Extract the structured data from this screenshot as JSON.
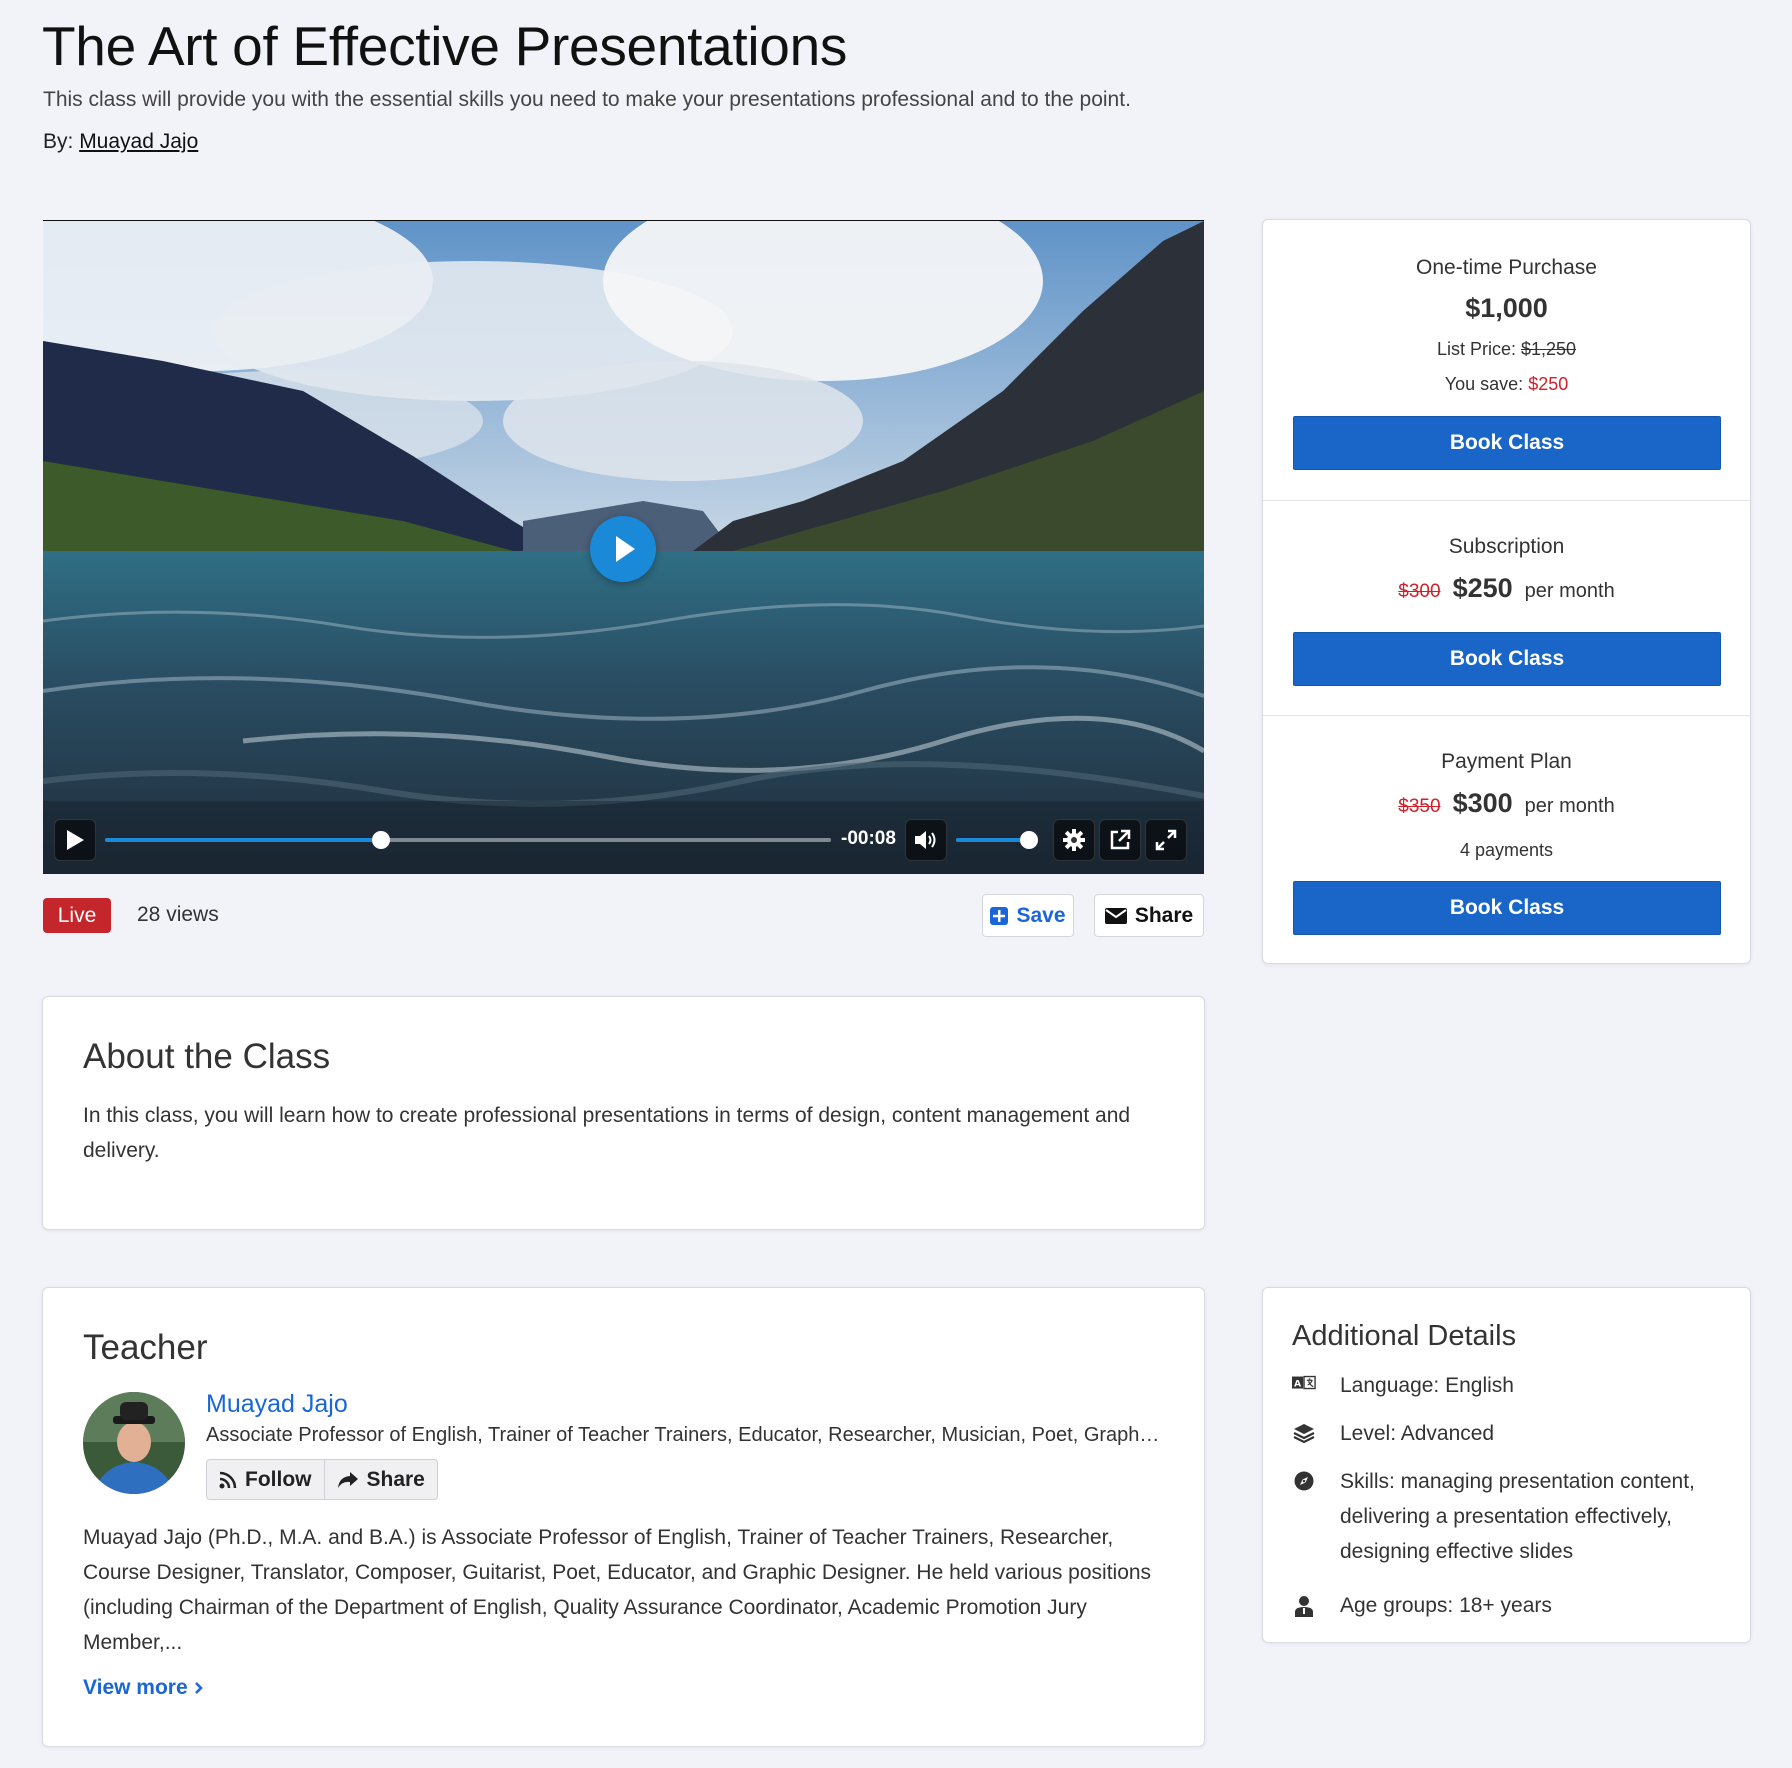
{
  "header": {
    "title": "The Art of Effective Presentations",
    "subtitle": "This class will provide you with the essential skills you need to make your presentations professional and to the point.",
    "by_label": "By:",
    "author": "Muayad Jajo"
  },
  "video": {
    "time_remaining": "-00:08",
    "progress": 0.38,
    "volume": 1.0
  },
  "stats": {
    "live_label": "Live",
    "views": "28 views",
    "save_label": "Save",
    "share_label": "Share"
  },
  "pricing": {
    "one_time": {
      "title": "One-time Purchase",
      "price": "$1,000",
      "list_price_label": "List Price:",
      "list_price": "$1,250",
      "you_save_label": "You save:",
      "you_save": "$250",
      "button": "Book Class"
    },
    "subscription": {
      "title": "Subscription",
      "old_price": "$300",
      "price": "$250",
      "period": "per month",
      "button": "Book Class"
    },
    "payment_plan": {
      "title": "Payment Plan",
      "old_price": "$350",
      "price": "$300",
      "period": "per month",
      "payments": "4 payments",
      "button": "Book Class"
    }
  },
  "about": {
    "heading": "About the Class",
    "text": "In this class, you will learn how to create professional presentations in terms of design, content management and delivery."
  },
  "teacher": {
    "heading": "Teacher",
    "name": "Muayad Jajo",
    "roles": "Associate Professor of English, Trainer of Teacher Trainers, Educator, Researcher, Musician, Poet, Graphic Designer",
    "follow_label": "Follow",
    "share_label": "Share",
    "bio": "Muayad Jajo (Ph.D., M.A. and B.A.) is Associate Professor of English, Trainer of Teacher Trainers, Researcher, Course Designer, Translator, Composer, Guitarist, Poet, Educator, and Graphic Designer.  He held various positions (including Chairman of the Department of English, Quality Assurance Coordinator, Academic Promotion Jury Member,...",
    "view_more": "View more"
  },
  "details": {
    "heading": "Additional Details",
    "items": [
      {
        "icon": "language-icon",
        "text": "Language: English"
      },
      {
        "icon": "layers-icon",
        "text": "Level: Advanced"
      },
      {
        "icon": "compass-icon",
        "text": "Skills: managing presentation content, delivering a presentation effectively, designing effective slides"
      },
      {
        "icon": "person-icon",
        "text": "Age groups: 18+ years"
      }
    ]
  },
  "colors": {
    "accent": "#1a66c8",
    "link": "#1a66d8",
    "live": "#c5262c",
    "savings": "#d0202a",
    "page_bg": "#f2f2f9"
  }
}
